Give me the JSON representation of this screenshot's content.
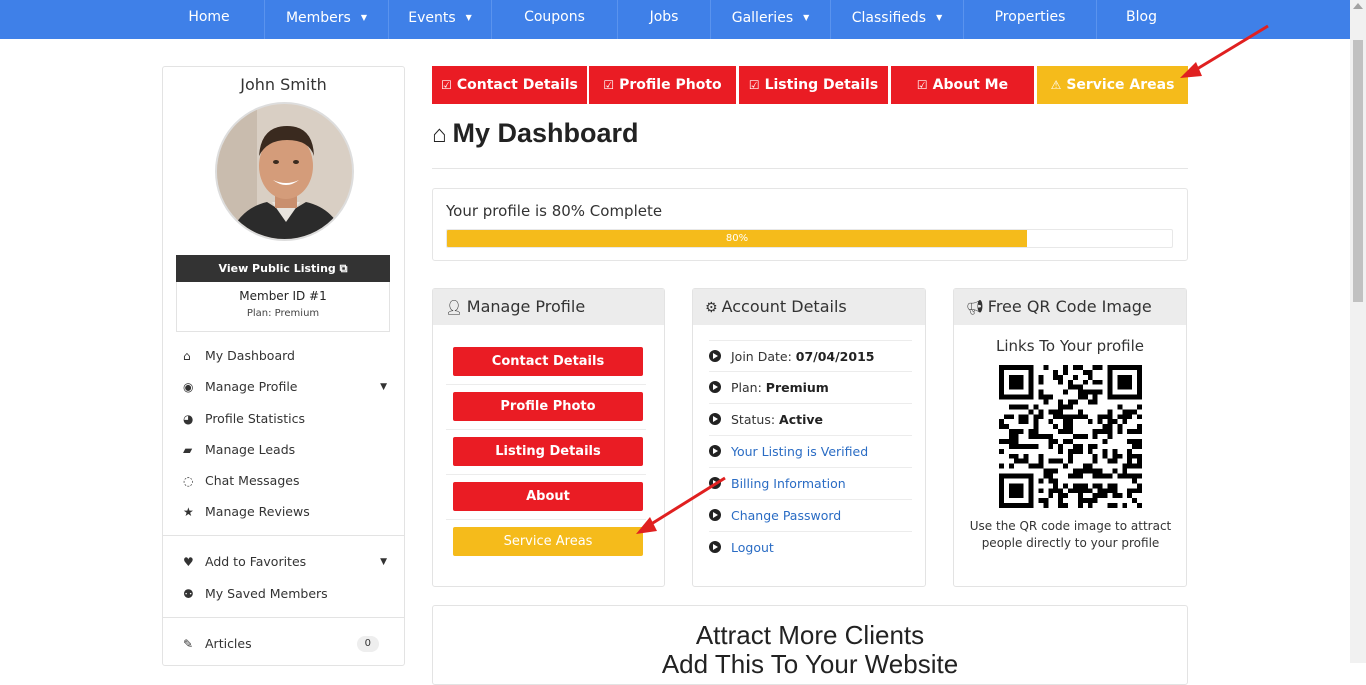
{
  "nav": {
    "items": [
      {
        "label": "Home",
        "caret": ""
      },
      {
        "label": "Members",
        "caret": "▼"
      },
      {
        "label": "Events",
        "caret": "▼"
      },
      {
        "label": "Coupons",
        "caret": ""
      },
      {
        "label": "Jobs",
        "caret": ""
      },
      {
        "label": "Galleries",
        "caret": "▼"
      },
      {
        "label": "Classifieds",
        "caret": "▼"
      },
      {
        "label": "Properties",
        "caret": ""
      },
      {
        "label": "Blog",
        "caret": ""
      }
    ]
  },
  "profile": {
    "name": "John Smith",
    "view_listing_label": "View Public Listing",
    "member_id": "Member ID #1",
    "plan": "Plan: Premium"
  },
  "sidebar": {
    "items": [
      {
        "label": "My Dashboard",
        "icon": "home-icon"
      },
      {
        "label": "Manage Profile",
        "icon": "user-circle-icon"
      },
      {
        "label": "Profile Statistics",
        "icon": "pie-chart-icon"
      },
      {
        "label": "Manage Leads",
        "icon": "folder-open-icon"
      },
      {
        "label": "Chat Messages",
        "icon": "comments-icon"
      },
      {
        "label": "Manage Reviews",
        "icon": "star-icon"
      },
      {
        "label": "Add to Favorites",
        "icon": "heart-icon"
      },
      {
        "label": "My Saved Members",
        "icon": "user-plus-icon"
      },
      {
        "label": "Articles",
        "icon": "pencil-icon",
        "count": "0"
      }
    ]
  },
  "tabs": [
    {
      "label": "Contact Details",
      "icon": "edit-icon"
    },
    {
      "label": "Profile Photo",
      "icon": "edit-icon"
    },
    {
      "label": "Listing Details",
      "icon": "edit-icon"
    },
    {
      "label": "About Me",
      "icon": "edit-icon"
    },
    {
      "label": "Service Areas",
      "icon": "warning-icon"
    }
  ],
  "dashboard": {
    "title": "My Dashboard",
    "progress_text": "Your profile is 80% Complete",
    "progress_value": 80,
    "progress_label": "80%"
  },
  "manage_profile": {
    "title": "Manage Profile",
    "buttons": [
      "Contact Details",
      "Profile Photo",
      "Listing Details",
      "About",
      "Service Areas"
    ]
  },
  "account": {
    "title": "Account Details",
    "rows": [
      {
        "label": "Join Date: ",
        "value": "07/04/2015"
      },
      {
        "label": "Plan: ",
        "value": "Premium"
      },
      {
        "label": "Status: ",
        "value": "Active"
      }
    ],
    "links": [
      "Your Listing is Verified",
      "Billing Information",
      "Change Password",
      "Logout"
    ]
  },
  "qr": {
    "title": "Free QR Code Image",
    "links_text": "Links To Your profile",
    "description": "Use the QR code image to attract people directly to your profile"
  },
  "attract": {
    "title": "Attract More Clients",
    "subtitle": "Add This To Your Website"
  },
  "colors": {
    "nav": "#3f80e8",
    "red": "#ea1c24",
    "yellow": "#f5bb1b",
    "dark": "#333333"
  }
}
